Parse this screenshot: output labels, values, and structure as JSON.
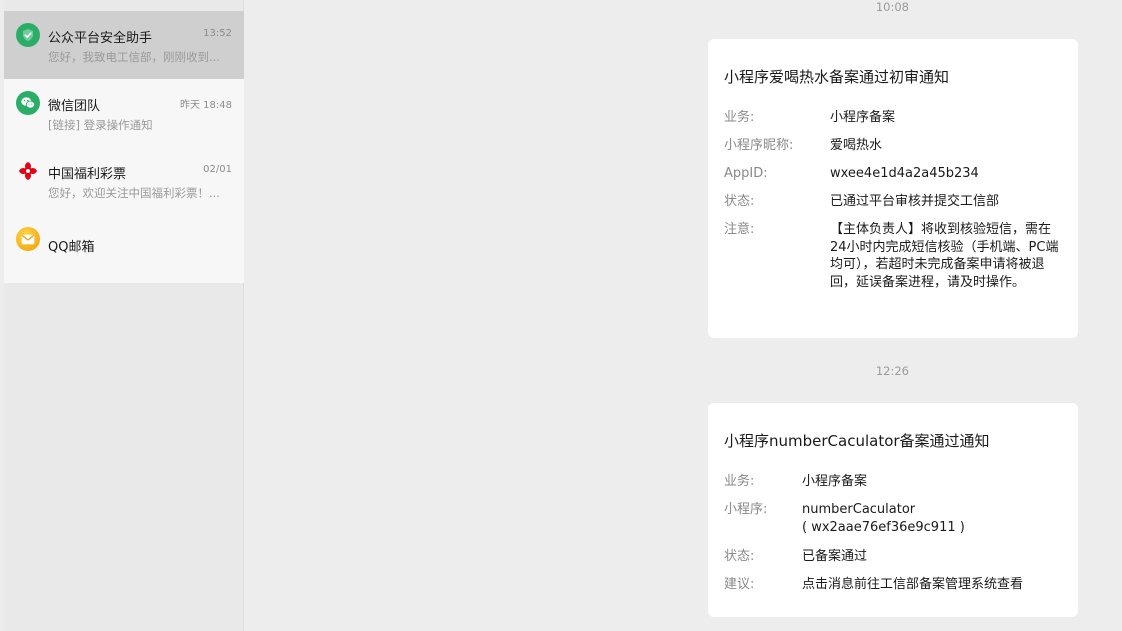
{
  "sidebar": {
    "chats": [
      {
        "name": "公众平台安全助手",
        "time": "13:52",
        "preview": "您好，我致电工信部，刚刚收到...",
        "icon": "shield-check-icon",
        "color": "#2aae67"
      },
      {
        "name": "微信团队",
        "time": "昨天 18:48",
        "preview": "[链接] 登录操作通知",
        "icon": "wechat-icon",
        "color": "#2aae67"
      },
      {
        "name": "中国福利彩票",
        "time": "02/01",
        "preview": "您好，欢迎关注中国福利彩票！...",
        "icon": "lottery-logo-icon",
        "color": "#e60012"
      },
      {
        "name": "QQ邮箱",
        "time": "",
        "preview": "",
        "icon": "mail-icon",
        "color": "#f5b400"
      }
    ]
  },
  "messages": [
    {
      "time": "10:08",
      "title": "小程序爱喝热水备案通过初审通知",
      "fields": [
        {
          "label": "业务:",
          "value": "小程序备案"
        },
        {
          "label": "小程序昵称:",
          "value": "爱喝热水"
        },
        {
          "label": "AppID:",
          "value": "wxee4e1d4a2a45b234"
        },
        {
          "label": "状态:",
          "value": "已通过平台审核并提交工信部"
        },
        {
          "label": "注意:",
          "value": "【主体负责人】将收到核验短信，需在24小时内完成短信核验（手机端、PC端均可），若超时未完成备案申请将被退回，延误备案进程，请及时操作。"
        }
      ]
    },
    {
      "time": "12:26",
      "title": "小程序numberCaculator备案通过通知",
      "fields": [
        {
          "label": "业务:",
          "value": "小程序备案"
        },
        {
          "label": "小程序:",
          "value": "numberCaculator",
          "value2": "( wx2aae76ef36e9c911 )"
        },
        {
          "label": "状态:",
          "value": "已备案通过"
        },
        {
          "label": "建议:",
          "value": "点击消息前往工信部备案管理系统查看"
        }
      ]
    }
  ]
}
